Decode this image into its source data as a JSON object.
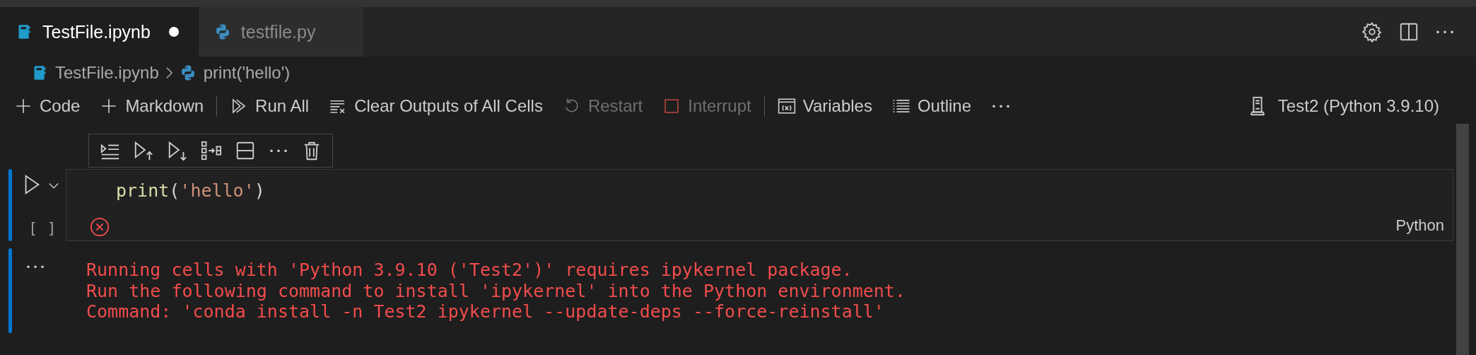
{
  "tabs": [
    {
      "label": "TestFile.ipynb",
      "kind": "notebook",
      "selected": true,
      "modified": true
    },
    {
      "label": "testfile.py",
      "kind": "python",
      "selected": false,
      "modified": false
    }
  ],
  "breadcrumbs": [
    {
      "label": "TestFile.ipynb",
      "kind": "notebook"
    },
    {
      "label": "print('hello')",
      "kind": "python"
    }
  ],
  "toolbar": [
    {
      "kind": "plus",
      "label": "Code",
      "disabled": false
    },
    {
      "kind": "plus",
      "label": "Markdown",
      "disabled": false
    },
    {
      "kind": "separator"
    },
    {
      "kind": "run-all",
      "label": "Run All",
      "disabled": false
    },
    {
      "kind": "clear",
      "label": "Clear Outputs of All Cells",
      "disabled": false
    },
    {
      "kind": "restart",
      "label": "Restart",
      "disabled": true
    },
    {
      "kind": "interrupt",
      "label": "Interrupt",
      "disabled": true
    },
    {
      "kind": "separator"
    },
    {
      "kind": "variables",
      "label": "Variables",
      "disabled": false
    },
    {
      "kind": "outline",
      "label": "Outline",
      "disabled": false
    }
  ],
  "kernel": "Test2 (Python 3.9.10)",
  "cell": {
    "execution_count": "[ ]",
    "language": "Python",
    "error": true,
    "code": [
      {
        "kind": "function",
        "text": "print"
      },
      {
        "kind": "punct",
        "text": "("
      },
      {
        "kind": "string",
        "text": "'hello'"
      },
      {
        "kind": "punct",
        "text": ")"
      }
    ]
  },
  "output": [
    "Running cells with 'Python 3.9.10 ('Test2')' requires ipykernel package.",
    "Run the following command to install 'ipykernel' into the Python environment.",
    "Command: 'conda install -n Test2 ipykernel --update-deps --force-reinstall'"
  ]
}
